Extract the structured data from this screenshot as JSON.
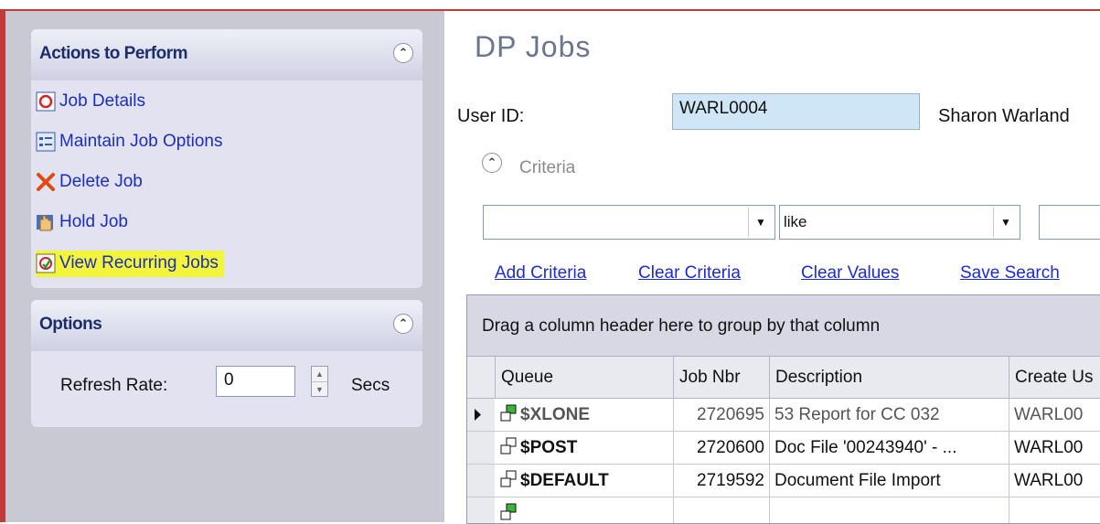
{
  "actions_panel": {
    "title": "Actions to Perform",
    "items": [
      {
        "label": "Job Details",
        "icon": "job-details-icon"
      },
      {
        "label": "Maintain Job Options",
        "icon": "options-icon"
      },
      {
        "label": "Delete Job",
        "icon": "delete-x-icon"
      },
      {
        "label": "Hold Job",
        "icon": "hold-hand-icon"
      },
      {
        "label": "View Recurring Jobs",
        "icon": "recurring-jobs-icon",
        "highlighted": true
      }
    ]
  },
  "options_panel": {
    "title": "Options",
    "refresh_label": "Refresh Rate:",
    "refresh_value": "0",
    "refresh_unit": "Secs"
  },
  "main": {
    "title": "DP Jobs",
    "user_id_label": "User ID:",
    "user_id_value": "WARL0004",
    "user_name": "Sharon Warland",
    "criteria_label": "Criteria",
    "field_combo_value": "",
    "operator_combo_value": "like",
    "links": [
      "Add Criteria",
      "Clear Criteria",
      "Clear Values",
      "Save Search"
    ]
  },
  "grid": {
    "group_hint": "Drag a column header here to group by that column",
    "columns": [
      "Queue",
      "Job Nbr",
      "Description",
      "Create Us"
    ],
    "rows": [
      {
        "queue": "$XLONE",
        "job_nbr": "2720695",
        "description": "53 Report for CC 032",
        "create_user": "WARL00",
        "current": true,
        "muted": true
      },
      {
        "queue": "$POST",
        "job_nbr": "2720600",
        "description": "Doc File '00243940' - ...",
        "create_user": "WARL00"
      },
      {
        "queue": "$DEFAULT",
        "job_nbr": "2719592",
        "description": "Document File Import",
        "create_user": "WARL00"
      }
    ]
  },
  "colors": {
    "accent_link": "#1d2ad6",
    "highlight": "#f2f53a",
    "panel_title": "#1c2d6b",
    "window_border": "#c23a3a"
  }
}
